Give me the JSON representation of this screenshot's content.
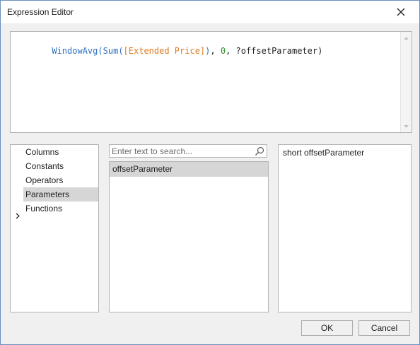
{
  "window": {
    "title": "Expression Editor",
    "close_icon": "close-icon"
  },
  "expression": {
    "tokens": [
      {
        "text": "WindowAvg",
        "kind": "fn"
      },
      {
        "text": "(",
        "kind": "fn"
      },
      {
        "text": "Sum",
        "kind": "fn"
      },
      {
        "text": "(",
        "kind": "fn"
      },
      {
        "text": "[Extended Price]",
        "kind": "field"
      },
      {
        "text": ")",
        "kind": "fn"
      },
      {
        "text": ", ",
        "kind": "plain"
      },
      {
        "text": "0",
        "kind": "num"
      },
      {
        "text": ", ?offsetParameter)",
        "kind": "plain"
      }
    ],
    "colors": {
      "fn": "#2f72c0",
      "field": "#e07a1f",
      "num": "#2f8f2f",
      "plain": "#1e1e1e"
    }
  },
  "categories": {
    "items": [
      {
        "label": "Columns",
        "selected": false
      },
      {
        "label": "Constants",
        "selected": false
      },
      {
        "label": "Operators",
        "selected": false
      },
      {
        "label": "Parameters",
        "selected": true
      },
      {
        "label": "Functions",
        "selected": false,
        "expandable": true
      }
    ]
  },
  "search": {
    "placeholder": "Enter text to search...",
    "value": "",
    "icon": "search-icon"
  },
  "items": {
    "list": [
      {
        "label": "offsetParameter",
        "selected": true
      }
    ]
  },
  "description": {
    "text": "short offsetParameter"
  },
  "buttons": {
    "ok_label": "OK",
    "cancel_label": "Cancel"
  }
}
